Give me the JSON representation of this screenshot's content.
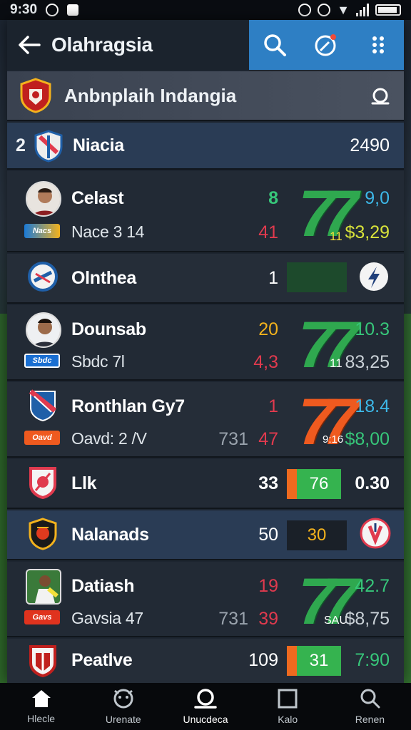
{
  "status": {
    "time": "9:30"
  },
  "app": {
    "title": "Olahragsia"
  },
  "league": {
    "name": "Anbnplaih Indangia"
  },
  "header_row": {
    "rank": "2",
    "team": "Niacia",
    "value": "2490"
  },
  "rows": [
    {
      "name": "Celast",
      "sub": "Nace 3 14",
      "a": "8",
      "b": "41",
      "big": "77",
      "small": "11",
      "r1": "9,0",
      "r2": "$3,29"
    },
    {
      "name": "Olnthea",
      "a": "1"
    },
    {
      "name": "Dounsab",
      "sub": "Sbdc 7l",
      "a": "20",
      "b": "4,3",
      "big": "77",
      "small": "11",
      "r1": "10.3",
      "r2": "83,25"
    },
    {
      "name": "Ronthlan Gy7",
      "sub": "Oavd: 2 /V",
      "c": "731",
      "a": "1",
      "b": "47",
      "big": "77",
      "small": "9:16",
      "r1": "18.4",
      "r2": "$8,00"
    },
    {
      "name": "Llk",
      "a": "33",
      "bar": "76",
      "r1": "0.30"
    },
    {
      "name": "Nalanads",
      "a": "50",
      "bar": "30"
    },
    {
      "name": "Datiash",
      "sub": "Gavsia 47",
      "c": "731",
      "a": "19",
      "b": "39",
      "big": "77",
      "small": "SAU",
      "r1": "42.7",
      "r2": "$8,75"
    },
    {
      "name": "Peatlve",
      "a": "109",
      "bar": "31",
      "r1": "7:90"
    }
  ],
  "badges": [
    "Nacs",
    "Sbdc",
    "Oavd",
    "Gavs"
  ],
  "nav": [
    {
      "label": "Hlecle"
    },
    {
      "label": "Urenate"
    },
    {
      "label": "Unucdeca"
    },
    {
      "label": "Kalo"
    },
    {
      "label": "Renen"
    }
  ],
  "colors": {
    "accent_blue": "#2e7fc4",
    "green": "#2fa84f",
    "red": "#e03a4e",
    "orange": "#ef6a1f",
    "yellow": "#f3b21d",
    "cyan": "#3db8e8"
  }
}
